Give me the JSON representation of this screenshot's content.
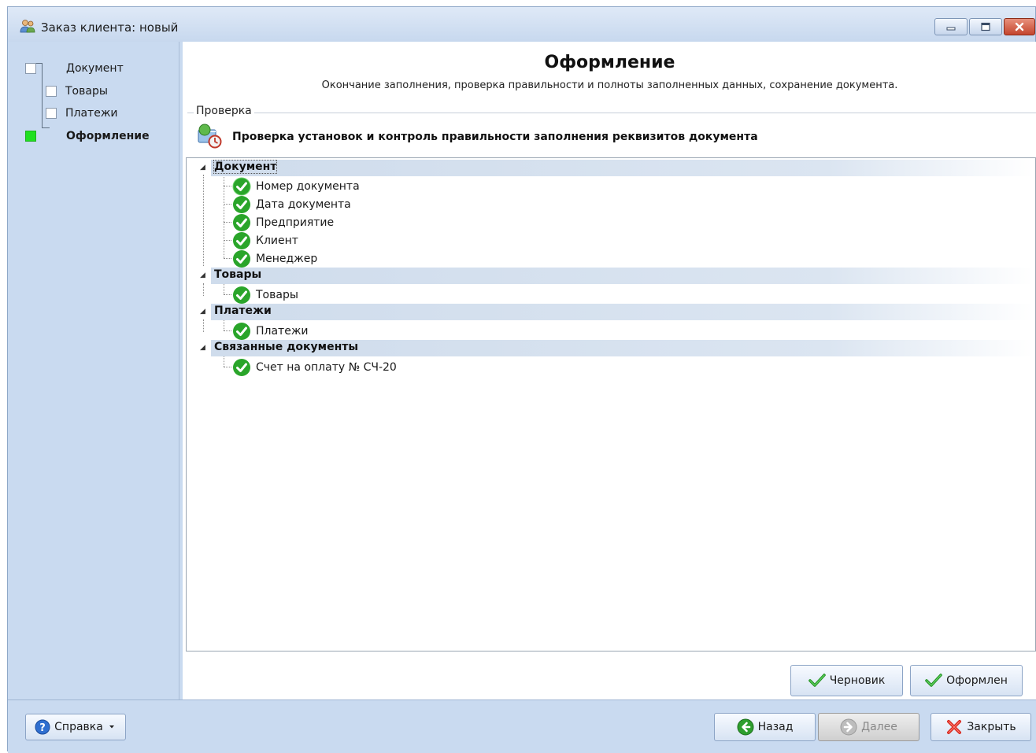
{
  "window": {
    "title": "Заказ клиента: новый",
    "app_icon": "users-icon"
  },
  "steps": [
    {
      "label": "Документ",
      "done": false
    },
    {
      "label": "Товары",
      "done": false
    },
    {
      "label": "Платежи",
      "done": false
    },
    {
      "label": "Оформление",
      "done": true,
      "active": true
    }
  ],
  "page": {
    "title": "Оформление",
    "subtitle": "Окончание заполнения, проверка правильности и полноты заполненных данных, сохранение документа."
  },
  "check": {
    "group_label": "Проверка",
    "heading": "Проверка установок и контроль правильности заполнения реквизитов документа"
  },
  "tree": {
    "groups": [
      {
        "title": "Документ",
        "items": [
          "Номер документа",
          "Дата документа",
          "Предприятие",
          "Клиент",
          "Менеджер"
        ]
      },
      {
        "title": "Товары",
        "items": [
          "Товары"
        ]
      },
      {
        "title": "Платежи",
        "items": [
          "Платежи"
        ]
      },
      {
        "title": "Связанные документы",
        "items": [
          "Счет на оплату № СЧ-20"
        ]
      }
    ]
  },
  "actions": {
    "draft": "Черновик",
    "finalize": "Оформлен"
  },
  "footer": {
    "help": "Справка",
    "back": "Назад",
    "next": "Далее",
    "close": "Закрыть"
  },
  "colors": {
    "window_bg": "#c9daf0",
    "step_done": "#20e020",
    "check_ok": "#2aa52a",
    "group_row": "#cfdcec"
  }
}
